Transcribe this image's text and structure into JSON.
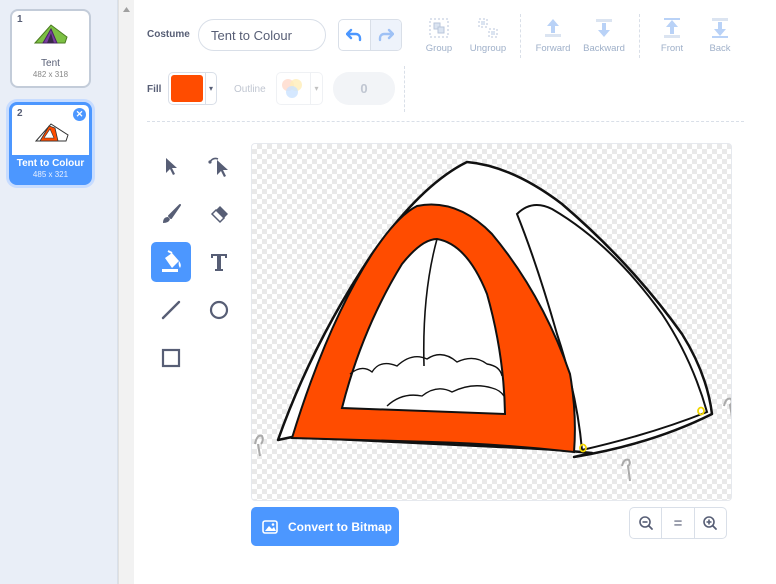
{
  "costumes": [
    {
      "number": "1",
      "name": "Tent",
      "dims": "482 x 318",
      "icon": "tent-green-thumbnail",
      "selected": false
    },
    {
      "number": "2",
      "name": "Tent to Colour",
      "dims": "485 x 321",
      "icon": "tent-orange-thumbnail",
      "selected": true
    }
  ],
  "toolbar": {
    "costume_label": "Costume",
    "costume_name": "Tent to Colour",
    "undo_icon": "undo-icon",
    "redo_icon": "redo-icon",
    "group_label": "Group",
    "ungroup_label": "Ungroup",
    "forward_label": "Forward",
    "backward_label": "Backward",
    "front_label": "Front",
    "back_label": "Back",
    "fill_label": "Fill",
    "fill_color": "#ff4c00",
    "outline_label": "Outline",
    "outline_width": "0"
  },
  "tools": [
    "select-icon",
    "reshape-icon",
    "brush-icon",
    "eraser-icon",
    "fill-icon",
    "text-icon",
    "line-icon",
    "circle-icon",
    "rectangle-icon"
  ],
  "active_tool": "fill-icon",
  "canvas": {
    "tent_color": "#ff4c00",
    "accent": "#4c97ff"
  },
  "footer": {
    "convert_label": "Convert to Bitmap",
    "zoom_out_icon": "zoom-out-icon",
    "zoom_reset_label": "=",
    "zoom_in_icon": "zoom-in-icon"
  }
}
